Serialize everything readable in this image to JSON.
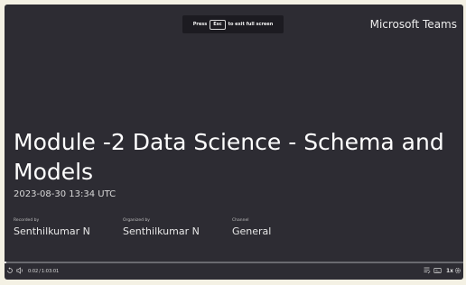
{
  "overlay": {
    "press_text": "Press",
    "esc_key": "Esc",
    "exit_text": "to exit full screen"
  },
  "brand": "Microsoft Teams",
  "title": "Module -2 Data Science - Schema and Models",
  "date": "2023-08-30 13:34 UTC",
  "meta": {
    "recorded_by_label": "Recorded by",
    "recorded_by": "Senthilkumar  N",
    "organized_by_label": "Organized by",
    "organized_by": "Senthilkumar  N",
    "channel_label": "Channel",
    "channel": "General"
  },
  "player": {
    "current_time": "0:02",
    "separator": "/",
    "duration": "1:03:01",
    "progress_fraction": 0.0005,
    "speed": "1x",
    "icons": [
      "rewind-icon",
      "volume-icon",
      "captions-icon",
      "transcript-icon",
      "settings-icon"
    ]
  },
  "colors": {
    "background": "#2d2c33",
    "frame_bg": "#f4f1e4",
    "text": "#ffffff"
  }
}
